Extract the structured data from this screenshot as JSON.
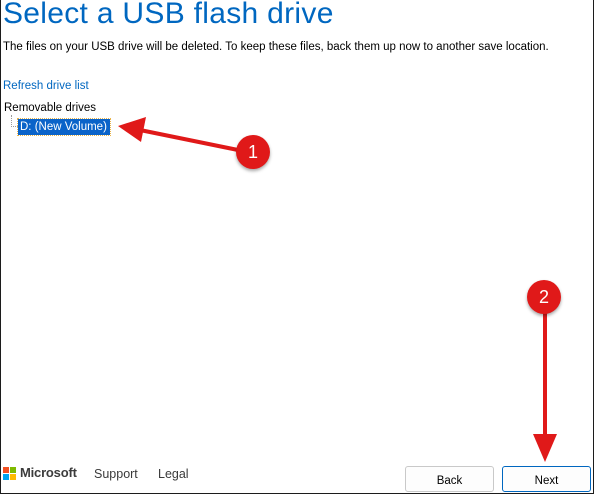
{
  "page": {
    "title": "Select a USB flash drive",
    "description": "The files on your USB drive will be deleted. To keep these files, back them up now to another save location.",
    "refresh_link": "Refresh drive list"
  },
  "drive_tree": {
    "root_label": "Removable drives",
    "items": [
      {
        "label": "D: (New Volume)",
        "selected": true
      }
    ]
  },
  "footer": {
    "brand": "Microsoft",
    "links": [
      "Support",
      "Legal"
    ],
    "back_label": "Back",
    "next_label": "Next"
  },
  "annotations": [
    {
      "number": "1"
    },
    {
      "number": "2"
    }
  ],
  "colors": {
    "title": "#0067c0",
    "selection": "#0a63c9",
    "annotation": "#e01919",
    "ms_red": "#f25022",
    "ms_green": "#7fba00",
    "ms_blue": "#00a4ef",
    "ms_yellow": "#ffb900"
  }
}
